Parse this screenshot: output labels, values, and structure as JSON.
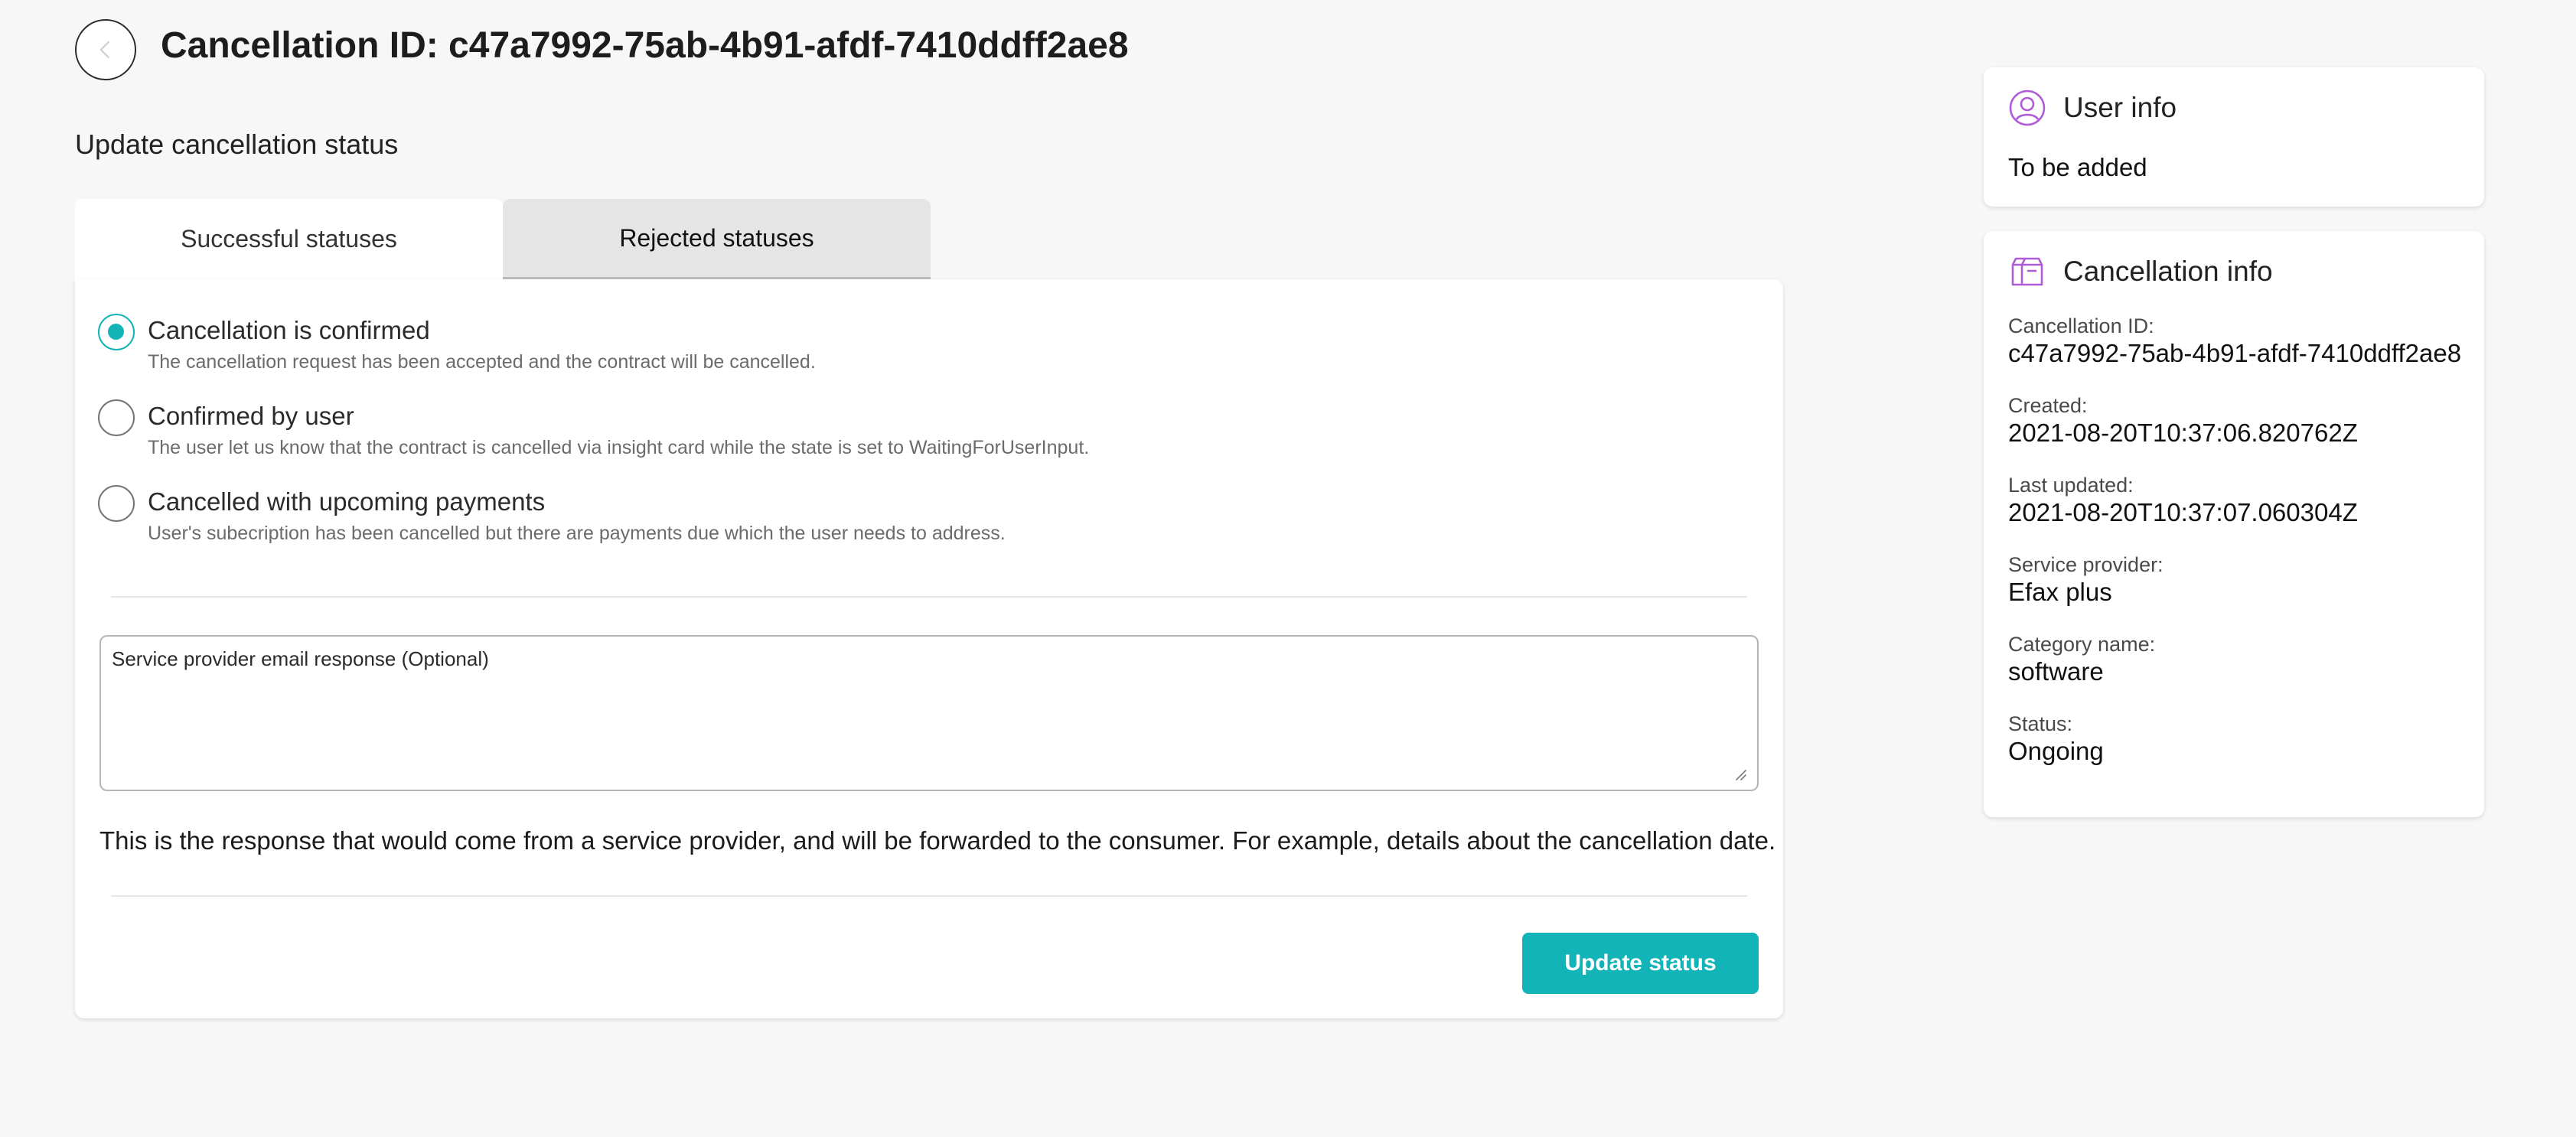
{
  "header": {
    "title": "Cancellation ID: c47a7992-75ab-4b91-afdf-7410ddff2ae8"
  },
  "update_section": {
    "title": "Update cancellation status",
    "tabs": [
      {
        "label": "Successful statuses",
        "active": true
      },
      {
        "label": "Rejected statuses",
        "active": false
      }
    ],
    "options": [
      {
        "label": "Cancellation is confirmed",
        "description": "The cancellation request has been accepted and the contract will be cancelled.",
        "checked": true
      },
      {
        "label": "Confirmed by user",
        "description": "The user let us know that the contract is cancelled via insight card while the state is set to WaitingForUserInput.",
        "checked": false
      },
      {
        "label": "Cancelled with upcoming payments",
        "description": "User's subecription has been cancelled but there are payments due which the user needs to address.",
        "checked": false
      }
    ],
    "email_response": {
      "placeholder": "Service provider email response (Optional)",
      "value": ""
    },
    "helper_text": "This is the response that would come from a service provider, and will be forwarded to the consumer. For example, details about the cancellation date.",
    "submit_label": "Update status"
  },
  "user_info": {
    "title": "User info",
    "text": "To be added"
  },
  "cancellation_info": {
    "title": "Cancellation info",
    "fields": [
      {
        "label": "Cancellation ID:",
        "value": "c47a7992-75ab-4b91-afdf-7410ddff2ae8"
      },
      {
        "label": "Created:",
        "value": "2021-08-20T10:37:06.820762Z"
      },
      {
        "label": "Last updated:",
        "value": "2021-08-20T10:37:07.060304Z"
      },
      {
        "label": "Service provider:",
        "value": "Efax plus"
      },
      {
        "label": "Category name:",
        "value": "software"
      },
      {
        "label": "Status:",
        "value": "Ongoing"
      }
    ]
  },
  "icons": {
    "back": "chevron-left-icon",
    "user_info": "user-circle-icon",
    "cancellation_info": "box-icon"
  },
  "colors": {
    "accent": "#12b4b8",
    "icon_purple": "#b05cd6",
    "background": "#f7f7f7",
    "tab_inactive": "#e5e5e5"
  }
}
